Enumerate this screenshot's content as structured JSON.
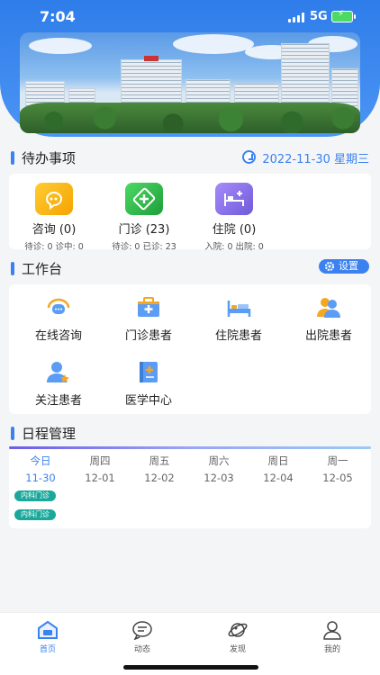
{
  "status": {
    "time": "7:04",
    "network": "5G"
  },
  "todo": {
    "title": "待办事项",
    "date": "2022-11-30 星期三",
    "items": [
      {
        "label": "咨询 (0)",
        "sub": "待诊: 0 诊中: 0"
      },
      {
        "label": "门诊 (23)",
        "sub": "待诊: 0 已诊: 23"
      },
      {
        "label": "住院 (0)",
        "sub": "入院: 0 出院: 0"
      }
    ]
  },
  "workbench": {
    "title": "工作台",
    "settings_label": "设置",
    "items": [
      {
        "label": "在线咨询"
      },
      {
        "label": "门诊患者"
      },
      {
        "label": "住院患者"
      },
      {
        "label": "出院患者"
      },
      {
        "label": "关注患者"
      },
      {
        "label": "医学中心"
      }
    ]
  },
  "schedule": {
    "title": "日程管理",
    "days": [
      {
        "name": "今日",
        "date": "11-30"
      },
      {
        "name": "周四",
        "date": "12-01"
      },
      {
        "name": "周五",
        "date": "12-02"
      },
      {
        "name": "周六",
        "date": "12-03"
      },
      {
        "name": "周日",
        "date": "12-04"
      },
      {
        "name": "周一",
        "date": "12-05"
      }
    ],
    "tags": [
      "内科门诊",
      "内科门诊"
    ]
  },
  "tabbar": {
    "items": [
      {
        "label": "首页"
      },
      {
        "label": "动态"
      },
      {
        "label": "发现"
      },
      {
        "label": "我的"
      }
    ]
  },
  "colors": {
    "primary": "#3b82f0",
    "tag": "#1aa89a"
  }
}
